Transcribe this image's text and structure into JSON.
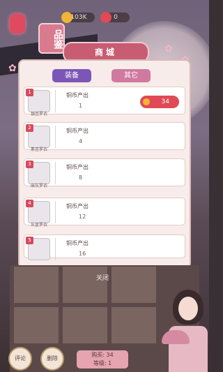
{
  "header": {
    "seal_label": "品鉴",
    "title": "商城",
    "currency": [
      {
        "name": "coin",
        "value": "103K",
        "color": "#f2b437"
      },
      {
        "name": "heart",
        "value": "0",
        "color": "#e04a55"
      }
    ]
  },
  "tabs": [
    {
      "label": "装备",
      "active": true
    },
    {
      "label": "其它",
      "active": false
    }
  ],
  "items": [
    {
      "badge": "1",
      "name": "银杏罗衣",
      "label": "铜币产出",
      "value": "1",
      "price": "34",
      "show_buy": true
    },
    {
      "badge": "2",
      "name": "素杏罗衣",
      "label": "铜币产出",
      "value": "4",
      "show_buy": false
    },
    {
      "badge": "3",
      "name": "麻灰罗衣",
      "label": "铜币产出",
      "value": "8",
      "show_buy": false
    },
    {
      "badge": "4",
      "name": "灰蓝罗衣",
      "label": "铜币产出",
      "value": "12",
      "show_buy": false
    },
    {
      "badge": "5",
      "name": "",
      "label": "铜币产出",
      "value": "16",
      "show_buy": false
    }
  ],
  "close_label": "关闭",
  "bottom": {
    "left_buttons": [
      "评论",
      "删除"
    ],
    "info_lines": [
      "购买: 34",
      "等级: 1"
    ]
  }
}
